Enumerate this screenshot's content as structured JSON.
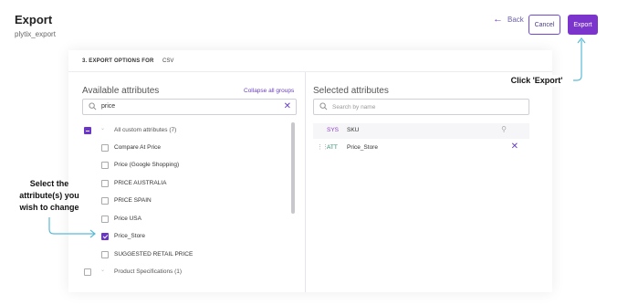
{
  "header": {
    "title": "Export",
    "subtitle": "plytix_export",
    "back_label": "Back",
    "cancel_label": "Cancel",
    "export_label": "Export"
  },
  "step": {
    "label": "3. EXPORT OPTIONS FOR",
    "value": "CSV"
  },
  "available": {
    "title": "Available attributes",
    "collapse_label": "Collapse all groups",
    "search_value": "price",
    "items": [
      {
        "label": "All custom attributes (7)",
        "kind": "group",
        "state": "partial"
      },
      {
        "label": "Compare At Price",
        "kind": "item",
        "state": "unchecked"
      },
      {
        "label": "Price (Google Shopping)",
        "kind": "item",
        "state": "unchecked"
      },
      {
        "label": "PRICE AUSTRALIA",
        "kind": "item",
        "state": "unchecked"
      },
      {
        "label": "PRICE SPAIN",
        "kind": "item",
        "state": "unchecked"
      },
      {
        "label": "Price USA",
        "kind": "item",
        "state": "unchecked"
      },
      {
        "label": "Price_Store",
        "kind": "item",
        "state": "checked"
      },
      {
        "label": "SUGGESTED RETAIL PRICE",
        "kind": "item",
        "state": "unchecked"
      },
      {
        "label": "Product Specifications (1)",
        "kind": "group",
        "state": "unchecked"
      }
    ]
  },
  "selected": {
    "title": "Selected attributes",
    "search_placeholder": "Search by name",
    "rows": [
      {
        "type": "SYS",
        "label": "SKU"
      },
      {
        "type": "ATT",
        "label": "Price_Store"
      }
    ]
  },
  "callouts": {
    "export": "Click 'Export'",
    "select": "Select the attribute(s) you wish to change"
  },
  "colors": {
    "accent": "#7b35cc",
    "callout_line": "#5bbad5",
    "sys_tag": "#8a3fc7",
    "att_tag": "#2a8a6b"
  }
}
